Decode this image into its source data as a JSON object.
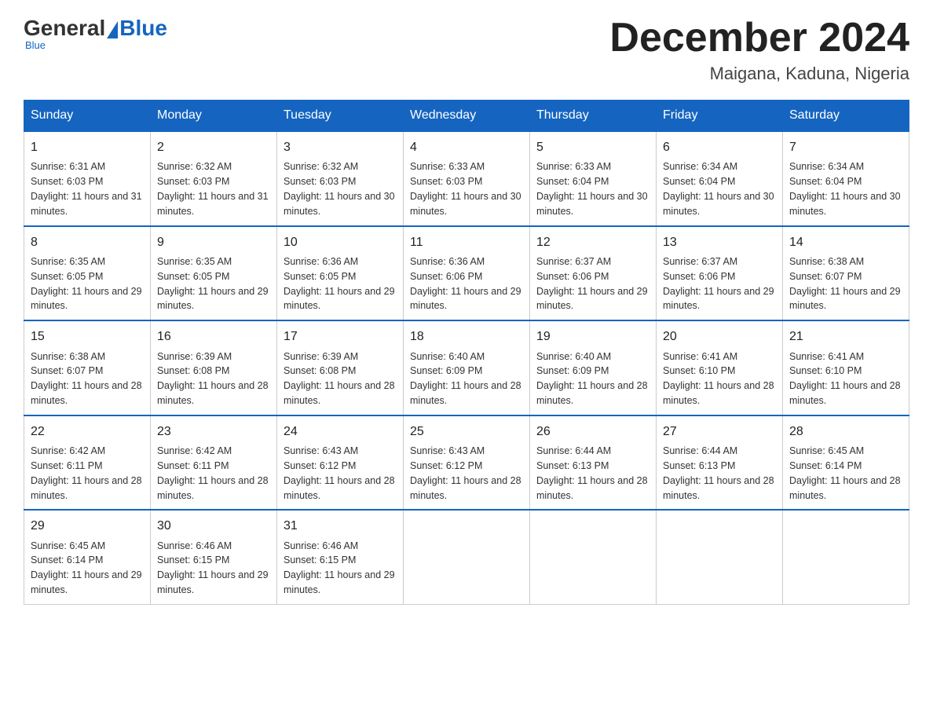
{
  "header": {
    "logo": {
      "text1": "General",
      "text2": "Blue"
    },
    "title": "December 2024",
    "subtitle": "Maigana, Kaduna, Nigeria"
  },
  "days_of_week": [
    "Sunday",
    "Monday",
    "Tuesday",
    "Wednesday",
    "Thursday",
    "Friday",
    "Saturday"
  ],
  "weeks": [
    [
      {
        "day": 1,
        "sunrise": "6:31 AM",
        "sunset": "6:03 PM",
        "daylight": "11 hours and 31 minutes"
      },
      {
        "day": 2,
        "sunrise": "6:32 AM",
        "sunset": "6:03 PM",
        "daylight": "11 hours and 31 minutes"
      },
      {
        "day": 3,
        "sunrise": "6:32 AM",
        "sunset": "6:03 PM",
        "daylight": "11 hours and 30 minutes"
      },
      {
        "day": 4,
        "sunrise": "6:33 AM",
        "sunset": "6:03 PM",
        "daylight": "11 hours and 30 minutes"
      },
      {
        "day": 5,
        "sunrise": "6:33 AM",
        "sunset": "6:04 PM",
        "daylight": "11 hours and 30 minutes"
      },
      {
        "day": 6,
        "sunrise": "6:34 AM",
        "sunset": "6:04 PM",
        "daylight": "11 hours and 30 minutes"
      },
      {
        "day": 7,
        "sunrise": "6:34 AM",
        "sunset": "6:04 PM",
        "daylight": "11 hours and 30 minutes"
      }
    ],
    [
      {
        "day": 8,
        "sunrise": "6:35 AM",
        "sunset": "6:05 PM",
        "daylight": "11 hours and 29 minutes"
      },
      {
        "day": 9,
        "sunrise": "6:35 AM",
        "sunset": "6:05 PM",
        "daylight": "11 hours and 29 minutes"
      },
      {
        "day": 10,
        "sunrise": "6:36 AM",
        "sunset": "6:05 PM",
        "daylight": "11 hours and 29 minutes"
      },
      {
        "day": 11,
        "sunrise": "6:36 AM",
        "sunset": "6:06 PM",
        "daylight": "11 hours and 29 minutes"
      },
      {
        "day": 12,
        "sunrise": "6:37 AM",
        "sunset": "6:06 PM",
        "daylight": "11 hours and 29 minutes"
      },
      {
        "day": 13,
        "sunrise": "6:37 AM",
        "sunset": "6:06 PM",
        "daylight": "11 hours and 29 minutes"
      },
      {
        "day": 14,
        "sunrise": "6:38 AM",
        "sunset": "6:07 PM",
        "daylight": "11 hours and 29 minutes"
      }
    ],
    [
      {
        "day": 15,
        "sunrise": "6:38 AM",
        "sunset": "6:07 PM",
        "daylight": "11 hours and 28 minutes"
      },
      {
        "day": 16,
        "sunrise": "6:39 AM",
        "sunset": "6:08 PM",
        "daylight": "11 hours and 28 minutes"
      },
      {
        "day": 17,
        "sunrise": "6:39 AM",
        "sunset": "6:08 PM",
        "daylight": "11 hours and 28 minutes"
      },
      {
        "day": 18,
        "sunrise": "6:40 AM",
        "sunset": "6:09 PM",
        "daylight": "11 hours and 28 minutes"
      },
      {
        "day": 19,
        "sunrise": "6:40 AM",
        "sunset": "6:09 PM",
        "daylight": "11 hours and 28 minutes"
      },
      {
        "day": 20,
        "sunrise": "6:41 AM",
        "sunset": "6:10 PM",
        "daylight": "11 hours and 28 minutes"
      },
      {
        "day": 21,
        "sunrise": "6:41 AM",
        "sunset": "6:10 PM",
        "daylight": "11 hours and 28 minutes"
      }
    ],
    [
      {
        "day": 22,
        "sunrise": "6:42 AM",
        "sunset": "6:11 PM",
        "daylight": "11 hours and 28 minutes"
      },
      {
        "day": 23,
        "sunrise": "6:42 AM",
        "sunset": "6:11 PM",
        "daylight": "11 hours and 28 minutes"
      },
      {
        "day": 24,
        "sunrise": "6:43 AM",
        "sunset": "6:12 PM",
        "daylight": "11 hours and 28 minutes"
      },
      {
        "day": 25,
        "sunrise": "6:43 AM",
        "sunset": "6:12 PM",
        "daylight": "11 hours and 28 minutes"
      },
      {
        "day": 26,
        "sunrise": "6:44 AM",
        "sunset": "6:13 PM",
        "daylight": "11 hours and 28 minutes"
      },
      {
        "day": 27,
        "sunrise": "6:44 AM",
        "sunset": "6:13 PM",
        "daylight": "11 hours and 28 minutes"
      },
      {
        "day": 28,
        "sunrise": "6:45 AM",
        "sunset": "6:14 PM",
        "daylight": "11 hours and 28 minutes"
      }
    ],
    [
      {
        "day": 29,
        "sunrise": "6:45 AM",
        "sunset": "6:14 PM",
        "daylight": "11 hours and 29 minutes"
      },
      {
        "day": 30,
        "sunrise": "6:46 AM",
        "sunset": "6:15 PM",
        "daylight": "11 hours and 29 minutes"
      },
      {
        "day": 31,
        "sunrise": "6:46 AM",
        "sunset": "6:15 PM",
        "daylight": "11 hours and 29 minutes"
      },
      null,
      null,
      null,
      null
    ]
  ]
}
